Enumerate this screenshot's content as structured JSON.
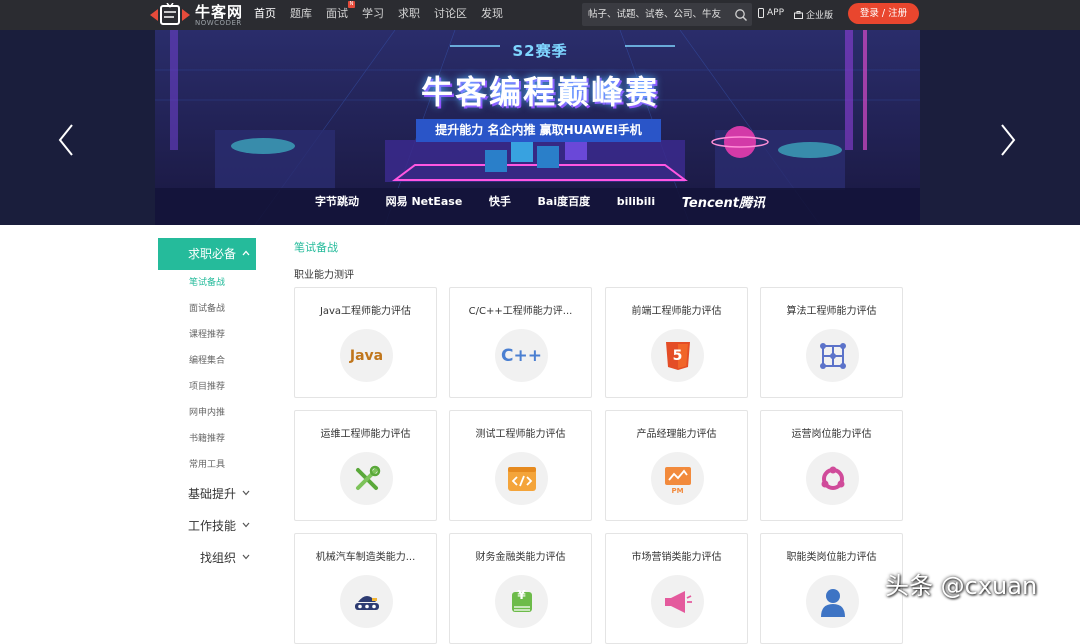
{
  "header": {
    "logo_text": "牛客网",
    "logo_sub": "NOWCODER",
    "nav": [
      {
        "label": "首页",
        "active": true
      },
      {
        "label": "题库"
      },
      {
        "label": "面试",
        "badge": "N"
      },
      {
        "label": "学习"
      },
      {
        "label": "求职"
      },
      {
        "label": "讨论区"
      },
      {
        "label": "发现"
      }
    ],
    "search_placeholder": "帖子、试题、试卷、公司、牛友",
    "app_label": "APP",
    "enterprise_label": "企业版",
    "login_label": "登录 / 注册"
  },
  "banner": {
    "season": "S2赛季",
    "title": "牛客编程巅峰赛",
    "slogan": "提升能力  名企内推  赢取HUAWEI手机",
    "partners": [
      "字节跳动",
      "网易 NetEase",
      "快手",
      "Bai度百度",
      "bilibili",
      "Tencent腾讯"
    ]
  },
  "sidebar": {
    "head": "求职必备",
    "subs": [
      "笔试备战",
      "面试备战",
      "课程推荐",
      "编程集合",
      "项目推荐",
      "网申内推",
      "书籍推荐",
      "常用工具"
    ],
    "groups": [
      "基础提升",
      "工作技能",
      "找组织"
    ]
  },
  "main": {
    "section_title": "笔试备战",
    "sub_title": "职业能力测评",
    "cards": [
      {
        "title": "Java工程师能力评估",
        "icon": "java-icon"
      },
      {
        "title": "C/C++工程师能力评...",
        "icon": "cpp-icon"
      },
      {
        "title": "前端工程师能力评估",
        "icon": "html5-icon"
      },
      {
        "title": "算法工程师能力评估",
        "icon": "algorithm-icon"
      },
      {
        "title": "运维工程师能力评估",
        "icon": "wrench-icon"
      },
      {
        "title": "测试工程师能力评估",
        "icon": "code-icon"
      },
      {
        "title": "产品经理能力评估",
        "icon": "pm-icon"
      },
      {
        "title": "运营岗位能力评估",
        "icon": "loop-icon"
      },
      {
        "title": "机械汽车制造类能力...",
        "icon": "vehicle-icon"
      },
      {
        "title": "财务金融类能力评估",
        "icon": "yen-icon"
      },
      {
        "title": "市场营销类能力评估",
        "icon": "megaphone-icon"
      },
      {
        "title": "职能类岗位能力评估",
        "icon": "person-icon"
      }
    ],
    "icon_texts": {
      "java": "Java",
      "cpp": "C++",
      "html5": "5",
      "pm": "PM",
      "yen": "¥"
    }
  },
  "watermark": "头条 @cxuan",
  "colors": {
    "accent": "#25bb9b",
    "login": "#e9462e",
    "topbar": "#2b2c31"
  }
}
